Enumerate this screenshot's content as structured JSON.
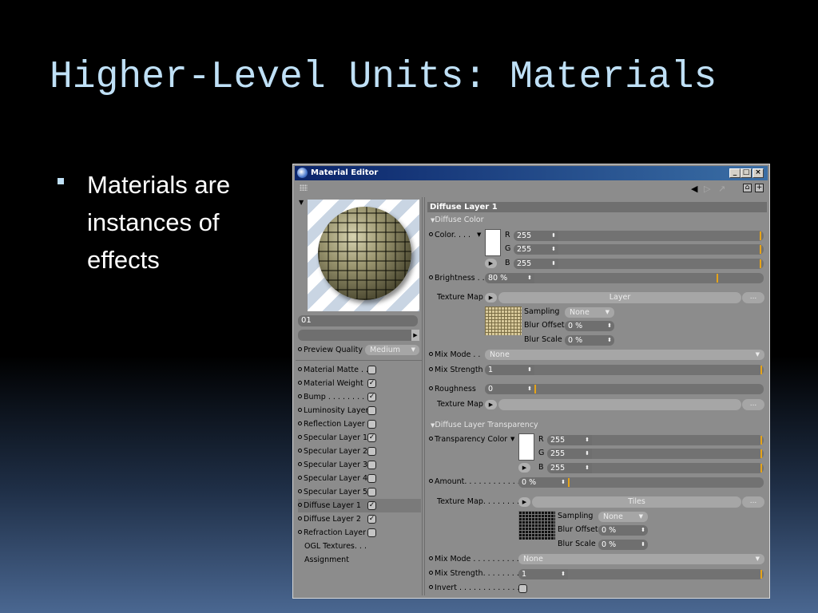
{
  "slide": {
    "title": "Higher-Level Units: Materials",
    "bullets": [
      "Materials are instances of effects"
    ]
  },
  "window": {
    "title": "Material Editor",
    "controls": {
      "minimize": "_",
      "maximize": "□",
      "close": "×"
    }
  },
  "left_panel": {
    "material_name": "01",
    "preview_quality_label": "Preview Quality",
    "preview_quality_value": "Medium",
    "channels": [
      {
        "label": "Material Matte . .",
        "checked": false
      },
      {
        "label": "Material Weight",
        "checked": true
      },
      {
        "label": "Bump . . . . . . . . .",
        "checked": true
      },
      {
        "label": "Luminosity Layer",
        "checked": false
      },
      {
        "label": "Reflection Layer",
        "checked": false
      },
      {
        "label": "Specular Layer 1",
        "checked": true
      },
      {
        "label": "Specular Layer 2",
        "checked": false
      },
      {
        "label": "Specular Layer 3",
        "checked": false
      },
      {
        "label": "Specular Layer 4",
        "checked": false
      },
      {
        "label": "Specular Layer 5",
        "checked": false
      },
      {
        "label": "Diffuse Layer 1",
        "checked": true,
        "selected": true
      },
      {
        "label": "Diffuse Layer 2",
        "checked": true
      },
      {
        "label": "Refraction Layer",
        "checked": false
      }
    ],
    "extra_items": [
      "OGL Textures. . .",
      "Assignment"
    ]
  },
  "diffuse": {
    "header": "Diffuse Layer 1",
    "color_section": "Diffuse Color",
    "color_label": "Color. . . .",
    "r_label": "R",
    "r_value": "255",
    "g_label": "G",
    "g_value": "255",
    "b_label": "B",
    "b_value": "255",
    "brightness_label": "Brightness . .",
    "brightness_value": "80 %",
    "brightness_level": 0.8,
    "texture_map_label": "Texture Map",
    "texture_button": "Layer",
    "more_button": "...",
    "sampling_label": "Sampling",
    "sampling_value": "None",
    "blur_offset_label": "Blur Offset",
    "blur_offset_value": "0 %",
    "blur_scale_label": "Blur Scale",
    "blur_scale_value": "0 %",
    "mix_mode_label": "Mix Mode . .",
    "mix_mode_value": "None",
    "mix_strength_label": "Mix Strength",
    "mix_strength_value": "1",
    "roughness_label": "Roughness",
    "roughness_value": "0",
    "texture_map2_label": "Texture Map"
  },
  "transparency": {
    "section": "Diffuse Layer Transparency",
    "color_label": "Transparency Color",
    "r_label": "R",
    "r_value": "255",
    "g_label": "G",
    "g_value": "255",
    "b_label": "B",
    "b_value": "255",
    "amount_label": "Amount. . . . . . . . . . . .",
    "amount_value": "0 %",
    "texture_map_label": "Texture Map. . . . . . . .",
    "texture_button": "Tiles",
    "more_button": "...",
    "sampling_label": "Sampling",
    "sampling_value": "None",
    "blur_offset_label": "Blur Offset",
    "blur_offset_value": "0 %",
    "blur_scale_label": "Blur Scale",
    "blur_scale_value": "0 %",
    "mix_mode_label": "Mix Mode . . . . . . . . . .",
    "mix_mode_value": "None",
    "mix_strength_label": "Mix Strength. . . . . . . .",
    "mix_strength_value": "1",
    "invert_label": "Invert . . . . . . . . . . . . . ."
  },
  "colors": {
    "title_text": "#bfe0f6",
    "window_bg": "#8c8c8c",
    "slider_marker": "#e6a419",
    "titlebar": "#0a246a"
  },
  "icons": {
    "bullet": "square-bullet",
    "app": "globe-icon",
    "toolbar": [
      "arrow-left-icon",
      "arrow-right-icon",
      "lock-icon",
      "new-window-icon"
    ]
  }
}
